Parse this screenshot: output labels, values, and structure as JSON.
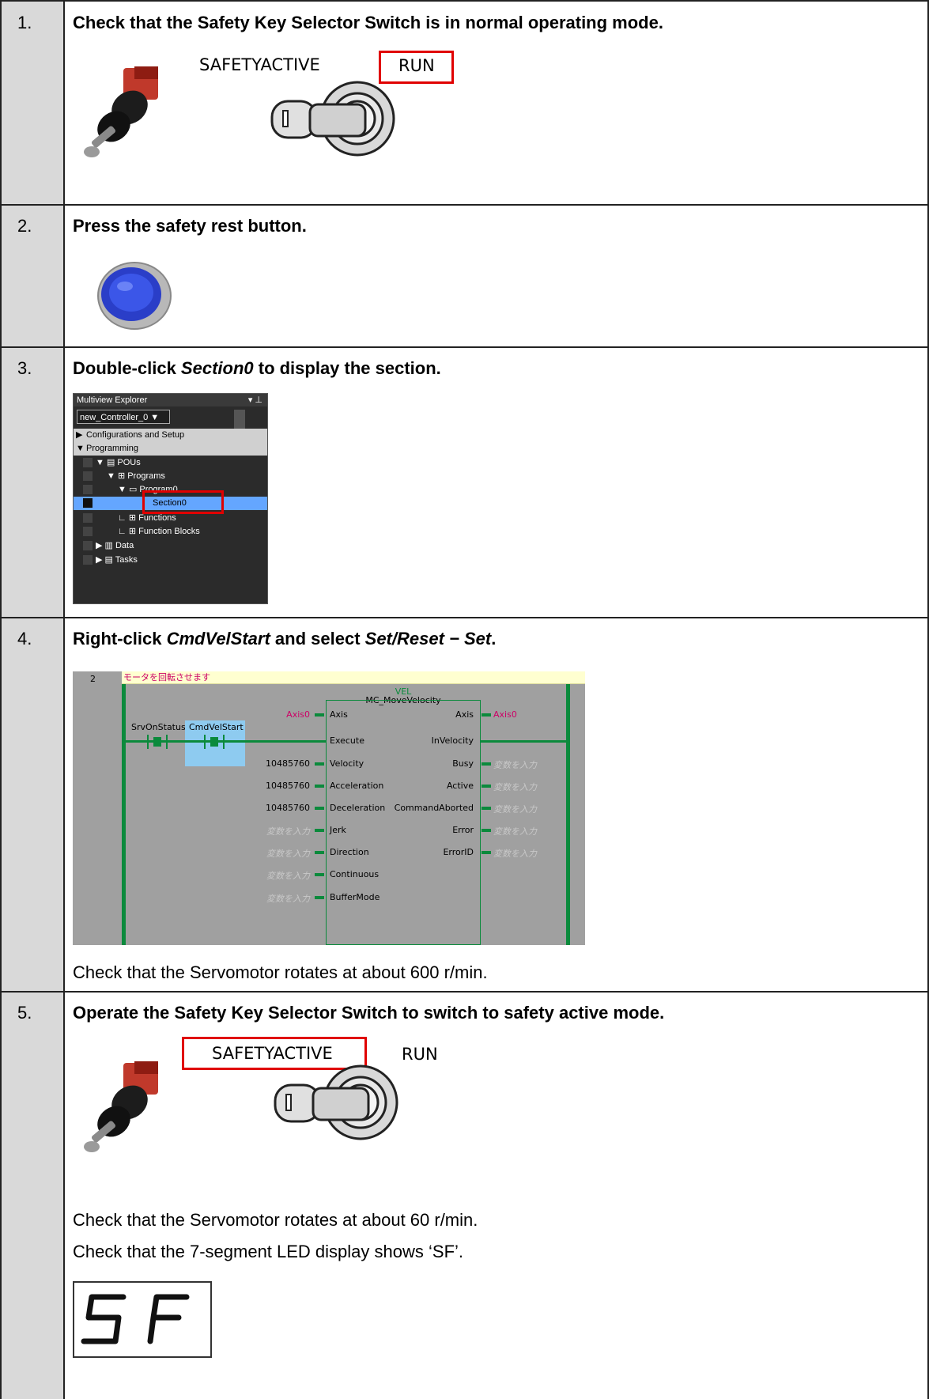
{
  "steps": [
    {
      "num": "1.",
      "instruction": "Check that the Safety Key Selector Switch is in normal operating mode.",
      "labels": {
        "safety": "SAFETYACTIVE",
        "run": "RUN"
      },
      "highlight": "RUN"
    },
    {
      "num": "2.",
      "instruction": "Press the safety rest button."
    },
    {
      "num": "3.",
      "instruction_pre": "Double-click ",
      "instruction_em": "Section0",
      "instruction_post": " to display the section.",
      "explorer": {
        "title": "Multiview Explorer",
        "controller": "new_Controller_0 ▼",
        "items": [
          "Configurations and Setup",
          "Programming",
          "POUs",
          "Programs",
          "Program0",
          "Section0",
          "Functions",
          "Function Blocks",
          "Data",
          "Tasks"
        ]
      }
    },
    {
      "num": "4.",
      "instruction_pre": "Right-click ",
      "instruction_em1": "CmdVelStart",
      "instruction_mid": " and select ",
      "instruction_em2": "Set/Reset − Set",
      "instruction_post": ".",
      "ladder": {
        "rung": "2",
        "comment": "モータを回転させます",
        "instance": "VEL",
        "fb_name": "MC_MoveVelocity",
        "contact1": "SrvOnStatus",
        "contact2": "CmdVelStart",
        "inputs": [
          "Axis",
          "Execute",
          "Velocity",
          "Acceleration",
          "Deceleration",
          "Jerk",
          "Direction",
          "Continuous",
          "BufferMode"
        ],
        "input_values": [
          "Axis0",
          "",
          "10485760",
          "10485760",
          "10485760",
          "変数を入力",
          "変数を入力",
          "変数を入力",
          "変数を入力"
        ],
        "outputs": [
          "Axis",
          "InVelocity",
          "Busy",
          "Active",
          "CommandAborted",
          "Error",
          "ErrorID"
        ],
        "output_values": [
          "Axis0",
          "",
          "変数を入力",
          "変数を入力",
          "変数を入力",
          "変数を入力",
          "変数を入力"
        ]
      },
      "check": "Check that the Servomotor rotates at about 600 r/min."
    },
    {
      "num": "5.",
      "instruction": "Operate the Safety Key Selector Switch to switch to safety active mode.",
      "labels": {
        "safety": "SAFETYACTIVE",
        "run": "RUN"
      },
      "highlight": "SAFETYACTIVE",
      "check1": "Check that the Servomotor rotates at about 60 r/min.",
      "check2": "Check that the 7-segment LED display shows ‘SF’.",
      "display": "SF"
    }
  ],
  "colors": {
    "highlight": "#e00000",
    "ladder_green": "#0b8a3c",
    "selection": "#64a6ff",
    "number_column": "#d9d9d9"
  }
}
